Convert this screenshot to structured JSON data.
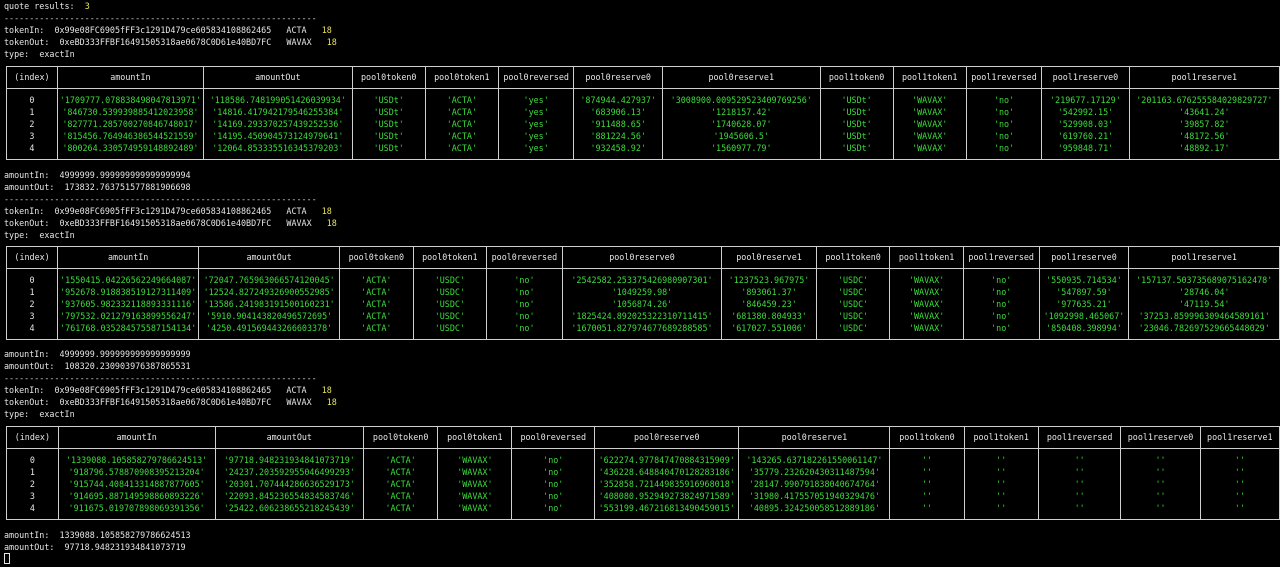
{
  "header": {
    "label": "quote results:",
    "count": "3"
  },
  "separator": "--------------------------------------------------------------",
  "columns": {
    "t1": [
      "(index)",
      "amountIn",
      "amountOut",
      "pool0token0",
      "pool0token1",
      "pool0reversed",
      "pool0reserve0",
      "pool0reserve1",
      "pool1token0",
      "pool1token1",
      "pool1reversed",
      "pool1reserve0",
      "pool1reserve1"
    ],
    "t2": [
      "(index)",
      "amountIn",
      "amountOut",
      "pool0token0",
      "pool0token1",
      "pool0reversed",
      "pool0reserve0",
      "pool0reserve1",
      "pool1token0",
      "pool1token1",
      "pool1reversed",
      "pool1reserve0",
      "pool1reserve1"
    ],
    "t3": [
      "(index)",
      "amountIn",
      "amountOut",
      "pool0token0",
      "pool0token1",
      "pool0reversed",
      "pool0reserve0",
      "pool0reserve1",
      "pool1token0",
      "pool1token1",
      "pool1reversed",
      "pool1reserve0",
      "pool1reserve1"
    ]
  },
  "quotes": [
    {
      "tokenIn": {
        "label": "tokenIn:",
        "address": "0x99e08FC6905fFF3c1291D479ce605834108862465",
        "symbol": "ACTA",
        "decimals": "18"
      },
      "tokenOut": {
        "label": "tokenOut:",
        "address": "0xeBD333FFBF16491505318ae0678C0D61e40BD7FC",
        "symbol": "WAVAX",
        "decimals": "18"
      },
      "type": {
        "label": "type:",
        "value": "exactIn"
      },
      "rows": [
        [
          "0",
          "'1709777.078838498047813971'",
          "'118586.748199051426039934'",
          "'USDt'",
          "'ACTA'",
          "'yes'",
          "'874944.427937'",
          "'3008900.009529523409769256'",
          "'USDt'",
          "'WAVAX'",
          "'no'",
          "'219677.17129'",
          "'201163.676255584029829727'"
        ],
        [
          "1",
          "'846730.539939885412023958'",
          "'14816.417942179546255384'",
          "'USDt'",
          "'ACTA'",
          "'yes'",
          "'683906.13'",
          "'1218157.42'",
          "'USDt'",
          "'WAVAX'",
          "'no'",
          "'542992.15'",
          "'43641.24'"
        ],
        [
          "2",
          "'827771.285700270846748017'",
          "'14169.293370257439252536'",
          "'USDt'",
          "'ACTA'",
          "'yes'",
          "'911488.65'",
          "'1740628.07'",
          "'USDt'",
          "'WAVAX'",
          "'no'",
          "'529908.03'",
          "'39857.82'"
        ],
        [
          "3",
          "'815456.764946386544521559'",
          "'14195.450904573124979641'",
          "'USDt'",
          "'ACTA'",
          "'yes'",
          "'881224.56'",
          "'1945606.5'",
          "'USDt'",
          "'WAVAX'",
          "'no'",
          "'619760.21'",
          "'48172.56'"
        ],
        [
          "4",
          "'800264.330574959148892489'",
          "'12064.853335516345379203'",
          "'USDt'",
          "'ACTA'",
          "'yes'",
          "'932458.92'",
          "'1560977.79'",
          "'USDt'",
          "'WAVAX'",
          "'no'",
          "'959848.71'",
          "'48892.17'"
        ]
      ],
      "amountIn": {
        "label": "amountIn:",
        "value": "4999999.999999999999999994"
      },
      "amountOut": {
        "label": "amountOut:",
        "value": "173832.763751577881906698"
      }
    },
    {
      "tokenIn": {
        "label": "tokenIn:",
        "address": "0x99e08FC6905fFF3c1291D479ce605834108862465",
        "symbol": "ACTA",
        "decimals": "18"
      },
      "tokenOut": {
        "label": "tokenOut:",
        "address": "0xeBD333FFBF16491505318ae0678C0D61e40BD7FC",
        "symbol": "WAVAX",
        "decimals": "18"
      },
      "type": {
        "label": "type:",
        "value": "exactIn"
      },
      "rows": [
        [
          "0",
          "'1550415.04226562249664087'",
          "'72047.765963066574120045'",
          "'ACTA'",
          "'USDC'",
          "'no'",
          "'2542582.253375426980907301'",
          "'1237523.967975'",
          "'USDC'",
          "'WAVAX'",
          "'no'",
          "'550935.714534'",
          "'157137.503735689075162478'"
        ],
        [
          "1",
          "'952678.918838519127311409'",
          "'12524.827249326900552985'",
          "'ACTA'",
          "'USDC'",
          "'no'",
          "'1049259.98'",
          "'893061.37'",
          "'USDC'",
          "'WAVAX'",
          "'no'",
          "'547897.59'",
          "'28746.04'"
        ],
        [
          "2",
          "'937605.982332118893331116'",
          "'13586.241983191500160231'",
          "'ACTA'",
          "'USDC'",
          "'no'",
          "'1056874.26'",
          "'846459.23'",
          "'USDC'",
          "'WAVAX'",
          "'no'",
          "'977635.21'",
          "'47119.54'"
        ],
        [
          "3",
          "'797532.021279163899556247'",
          "'5910.904143820496572695'",
          "'ACTA'",
          "'USDC'",
          "'no'",
          "'1825424.892025322310711415'",
          "'681380.804933'",
          "'USDC'",
          "'WAVAX'",
          "'no'",
          "'1092998.465067'",
          "'37253.859996309464589161'"
        ],
        [
          "4",
          "'761768.035284575587154134'",
          "'4250.491569443266603378'",
          "'ACTA'",
          "'USDC'",
          "'no'",
          "'1670051.827974677689288585'",
          "'617027.551006'",
          "'USDC'",
          "'WAVAX'",
          "'no'",
          "'850408.398994'",
          "'23046.782697529665448029'"
        ]
      ],
      "amountIn": {
        "label": "amountIn:",
        "value": "4999999.999999999999999999"
      },
      "amountOut": {
        "label": "amountOut:",
        "value": "108320.230903976387865531"
      }
    },
    {
      "tokenIn": {
        "label": "tokenIn:",
        "address": "0x99e08FC6905fFF3c1291D479ce605834108862465",
        "symbol": "ACTA",
        "decimals": "18"
      },
      "tokenOut": {
        "label": "tokenOut:",
        "address": "0xeBD333FFBF16491505318ae0678C0D61e40BD7FC",
        "symbol": "WAVAX",
        "decimals": "18"
      },
      "type": {
        "label": "type:",
        "value": "exactIn"
      },
      "rows": [
        [
          "0",
          "'1339088.105858279786624513'",
          "'97718.948231934841073719'",
          "'ACTA'",
          "'WAVAX'",
          "'no'",
          "'622274.977847470884315909'",
          "'143265.637182261550061147'",
          "''",
          "''",
          "''",
          "''",
          "''"
        ],
        [
          "1",
          "'918796.578870908395213204'",
          "'24237.203592955046499293'",
          "'ACTA'",
          "'WAVAX'",
          "'no'",
          "'436228.648840470128283186'",
          "'35779.232620430311487594'",
          "''",
          "''",
          "''",
          "''",
          "''"
        ],
        [
          "2",
          "'915744.408413314887877605'",
          "'20301.707444286636529173'",
          "'ACTA'",
          "'WAVAX'",
          "'no'",
          "'352858.721449835916968018'",
          "'28147.990791838040674764'",
          "''",
          "''",
          "''",
          "''",
          "''"
        ],
        [
          "3",
          "'914695.887149598860893226'",
          "'22093.845236554834583746'",
          "'ACTA'",
          "'WAVAX'",
          "'no'",
          "'408080.952949273824971589'",
          "'31980.417557051940329476'",
          "''",
          "''",
          "''",
          "''",
          "''"
        ],
        [
          "4",
          "'911675.019707898069391356'",
          "'25422.606238655218245439'",
          "'ACTA'",
          "'WAVAX'",
          "'no'",
          "'553199.467216813490459015'",
          "'40895.324250058512889186'",
          "''",
          "''",
          "''",
          "''",
          "''"
        ]
      ],
      "amountIn": {
        "label": "amountIn:",
        "value": "1339088.105858279786624513"
      },
      "amountOut": {
        "label": "amountOut:",
        "value": "97718.948231934841073719"
      }
    }
  ]
}
